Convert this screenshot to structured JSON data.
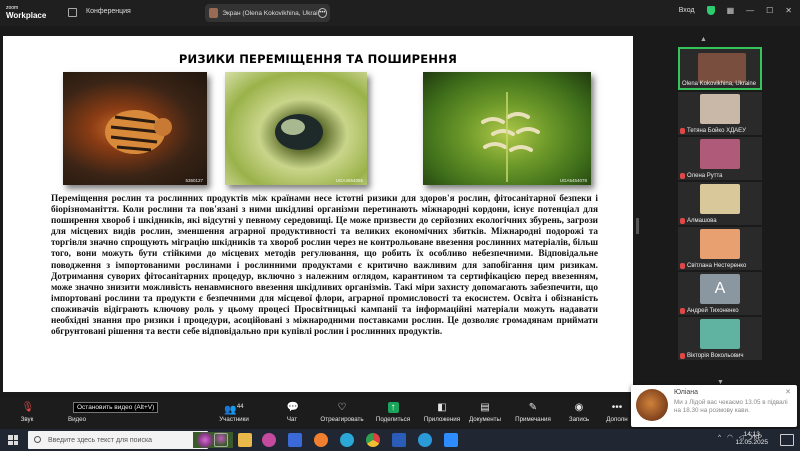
{
  "topbar": {
    "logo_line1": "zoom",
    "logo_line2": "Workplace",
    "conference": "Конференция",
    "screen_label": "Экран (Olena Kokovikhina, Ukrai",
    "signin": "Вход"
  },
  "slide": {
    "title": "РИЗИКИ ПЕРЕМІЩЕННЯ ТА ПОШИРЕННЯ",
    "photo_captions": [
      "5360127",
      "UGA4554065",
      "UGA5454078"
    ],
    "body": "Переміщення рослин та рослинних продуктів між країнами несе істотні ризики для здоров'я рослин, фітосанітарної безпеки і біорізноманіття. Коли рослини та пов'язані з ними шкідливі організми перетинають міжнародні кордони, існує потенціал для поширення хвороб і шкідників, які відсутні у певному середовищі. Це може призвести до серйозних екологічних збурень, загрози для місцевих видів рослин, зменшення аграрної продуктивності та великих економічних збитків. Міжнародні подорожі та торгівля значно спрощують міграцію шкідників та хвороб рослин через не контрольоване ввезення рослинних матеріалів, більш того, вони можуть бути стійкими до місцевих методів регулювання, що робить їх особливо небезпечними. Відповідальне поводження з імпортованими рослинами і рослинними продуктами є критично важливим для запобігання цим ризикам. Дотримання суворих фітосанітарних процедур, включно з належним оглядом, карантином та сертифікацією перед ввезенням, може значно знизити можливість ненавмисного ввезення шкідливих організмів. Такі міри захисту допомагають забезпечити, що імпортовані рослини та продукти є безпечними для місцевої флори, аграрної промисловості та екосистем. Освіта і обізнаність споживачів відіграють ключову роль у цьому процесі Просвітницькі кампанії та інформаційні матеріали можуть надавати необхідні знання про ризики і процедури, асоційовані з міжнародними поставками рослин. Це дозволяє громадянам приймати обгрунтовані рішення та вести себе відповідально при купівлі рослин і рослинних продуктів."
  },
  "participants": [
    {
      "name": "Olena Kokovikhina, Ukraine",
      "color": "#8a5a4a"
    },
    {
      "name": "Тетяна Бойко ХДАЕУ",
      "color": "#c9b7a8"
    },
    {
      "name": "Олена Рутта",
      "color": "#b05a7a"
    },
    {
      "name": "Алмашова",
      "color": "#d8c89a"
    },
    {
      "name": "Світлана Нестеренко",
      "color": "#e8a070"
    },
    {
      "name": "Андрей Тихоненко",
      "color": "#8a96a0",
      "initial": "A"
    },
    {
      "name": "Вікторія Вокольович",
      "color": "#5fb3a0"
    }
  ],
  "toolbar": {
    "tooltip": "Остановить видео (Alt+V)",
    "items": [
      {
        "label": "Звук",
        "icon": "mic-icon"
      },
      {
        "label": "Видео",
        "icon": "video-icon"
      },
      {
        "label": "Участники",
        "icon": "participants-icon",
        "count": "44"
      },
      {
        "label": "Чат",
        "icon": "chat-icon"
      },
      {
        "label": "Отреагировать",
        "icon": "heart-icon"
      },
      {
        "label": "Поделиться",
        "icon": "share-icon"
      },
      {
        "label": "Приложения",
        "icon": "apps-icon"
      },
      {
        "label": "Документы",
        "icon": "docs-icon"
      },
      {
        "label": "Примечания",
        "icon": "notes-icon"
      },
      {
        "label": "Запись",
        "icon": "record-icon"
      },
      {
        "label": "Дополн",
        "icon": "more-icon"
      }
    ]
  },
  "notification": {
    "name": "Юліана",
    "message": "Ми з Лідой вас чекаємо 13.05 в підвалі на 18.30  на розмову кави."
  },
  "taskbar": {
    "search_placeholder": "Введите здесь текст для поиска",
    "lang": "УКР",
    "time": "14:13",
    "date": "12.05.2025"
  }
}
